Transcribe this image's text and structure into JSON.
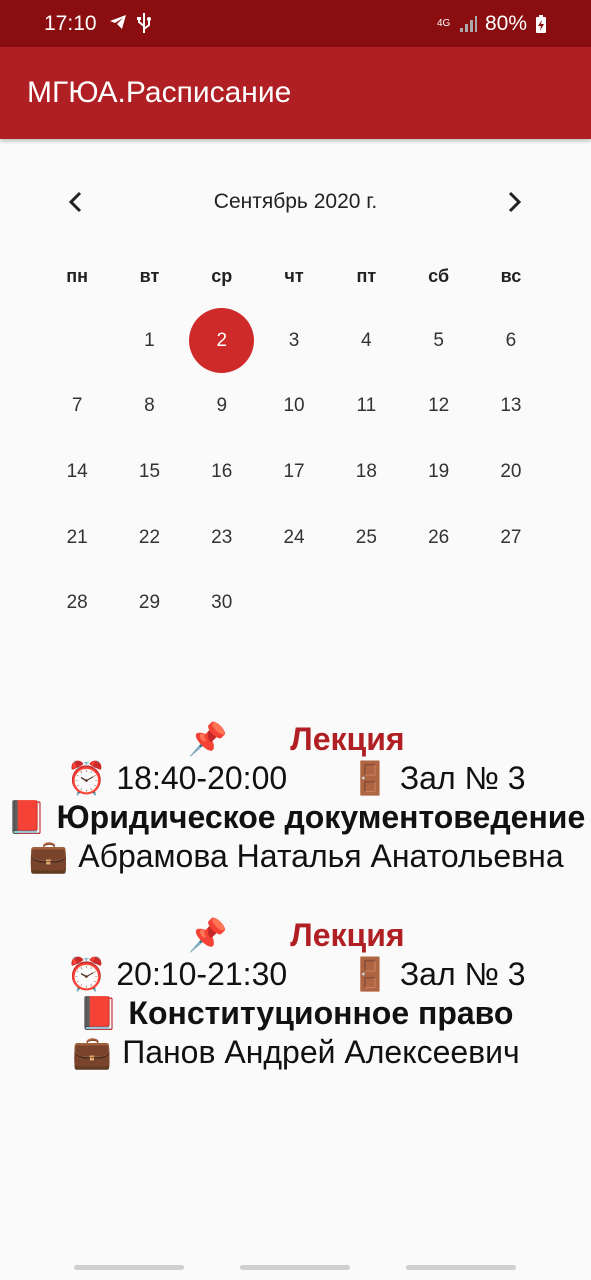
{
  "status_bar": {
    "time": "17:10",
    "network": "4G",
    "battery": "80%"
  },
  "app_bar": {
    "title": "МГЮА.Расписание"
  },
  "calendar": {
    "month_title": "Сентябрь 2020 г.",
    "weekdays": [
      "пн",
      "вт",
      "ср",
      "чт",
      "пт",
      "сб",
      "вс"
    ],
    "selected_day": "2",
    "days": [
      "1",
      "2",
      "3",
      "4",
      "5",
      "6",
      "7",
      "8",
      "9",
      "10",
      "11",
      "12",
      "13",
      "14",
      "15",
      "16",
      "17",
      "18",
      "19",
      "20",
      "21",
      "22",
      "23",
      "24",
      "25",
      "26",
      "27",
      "28",
      "29",
      "30"
    ]
  },
  "events": [
    {
      "type": "Лекция",
      "time": "18:40-20:00",
      "room": "Зал № 3",
      "subject": "Юридическое документоведение",
      "teacher": "Абрамова Наталья Анатольевна"
    },
    {
      "type": "Лекция",
      "time": "20:10-21:30",
      "room": "Зал № 3",
      "subject": "Конституционное право",
      "teacher": "Панов Андрей Алексеевич"
    }
  ],
  "colors": {
    "status_bar": "#8a0d10",
    "app_bar": "#b01f23",
    "selected_day": "#cf2a2a",
    "accent_text": "#b01f23"
  }
}
